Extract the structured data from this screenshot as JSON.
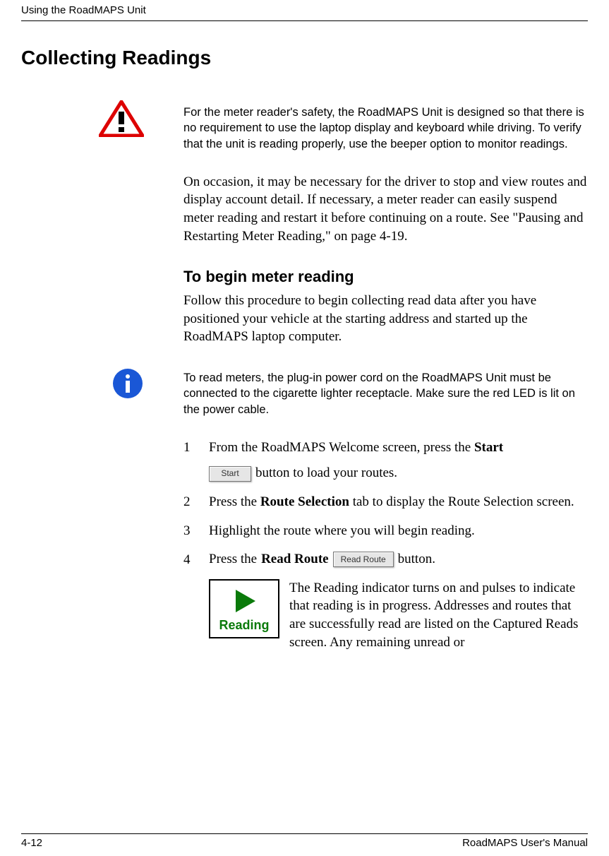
{
  "header": {
    "running": "Using the RoadMAPS Unit"
  },
  "section_title": "Collecting Readings",
  "warning": {
    "text": "For the meter reader's safety, the RoadMAPS Unit is designed so that there is no requirement to use the laptop display and keyboard while driving. To verify that the unit is reading properly, use the beeper option to monitor readings."
  },
  "intro_para": "On occasion, it may be necessary for the driver to stop and view routes and display account detail. If necessary, a meter reader can easily suspend meter reading and restart it before continuing on a route. See \"Pausing and Restarting Meter Reading,\" on page 4-19.",
  "subhead": "To begin meter reading",
  "subhead_para": "Follow this procedure to begin collecting read data after you have positioned your vehicle at the starting address and started up the RoadMAPS laptop computer.",
  "info": {
    "text": "To read meters, the plug-in power cord on the RoadMAPS Unit must be connected to the cigarette lighter receptacle. Make sure the red LED is lit on the power cable."
  },
  "steps": {
    "s1": {
      "num": "1",
      "pre": "From the RoadMAPS Welcome screen, press the ",
      "bold": "Start",
      "button_label": "Start",
      "post": " button to load your routes."
    },
    "s2": {
      "num": "2",
      "pre": "Press the ",
      "bold": "Route Selection",
      "post": " tab to display the Route Selection screen."
    },
    "s3": {
      "num": "3",
      "text": "Highlight the route where you will begin reading."
    },
    "s4": {
      "num": "4",
      "pre": "Press the ",
      "bold": "Read Route",
      "button_label": "Read Route",
      "post": " button."
    }
  },
  "reading": {
    "indicator_label": "Reading",
    "para": "The Reading indicator turns on and pulses to indicate that reading is in progress. Addresses and routes that are successfully read are listed on the Captured Reads screen. Any remaining unread or"
  },
  "footer": {
    "left": "4-12",
    "right": "RoadMAPS User's Manual"
  }
}
